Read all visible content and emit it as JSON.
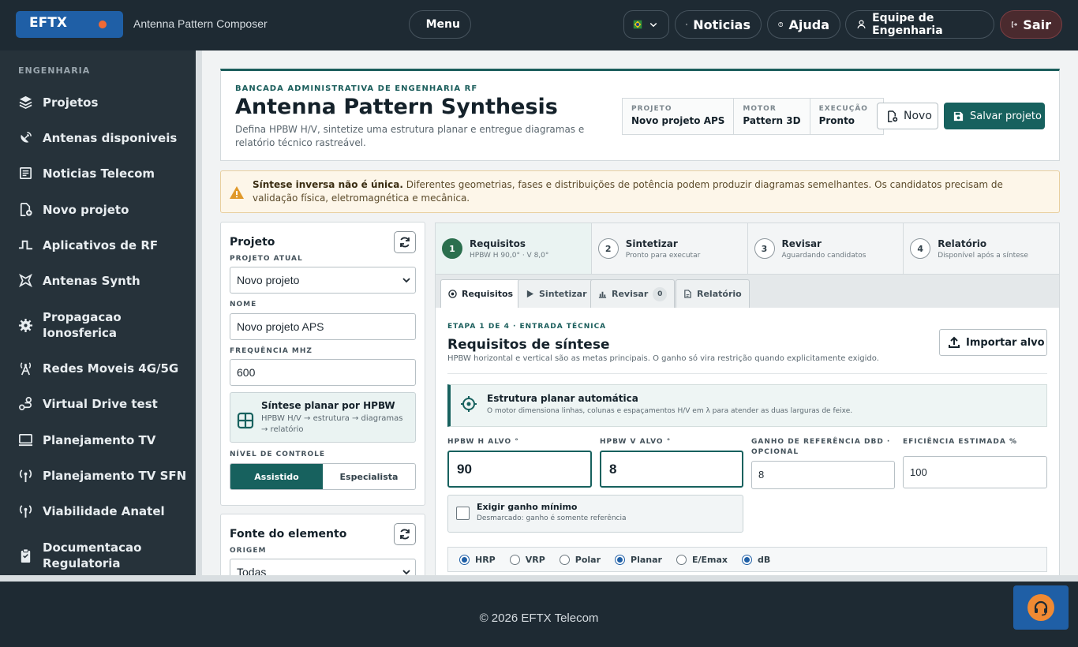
{
  "topbar": {
    "brand": "EFTX",
    "app_name": "Antenna Pattern Composer",
    "menu_label": "Menu",
    "news_label": "Noticias",
    "help_label": "Ajuda",
    "team_label": "Equipe de Engenharia",
    "exit_label": "Sair",
    "accent_color": "#1f5fa6"
  },
  "sidebar": {
    "section": "ENGENHARIA",
    "items": [
      {
        "label": "Projetos",
        "icon": "layers-icon"
      },
      {
        "label": "Antenas disponiveis",
        "icon": "satellite-dish-icon"
      },
      {
        "label": "Noticias Telecom",
        "icon": "newspaper-icon"
      },
      {
        "label": "Novo projeto",
        "icon": "file-plus-icon"
      },
      {
        "label": "Aplicativos de RF",
        "icon": "pulse-icon"
      },
      {
        "label": "Antenas Synth",
        "icon": "synth-icon"
      },
      {
        "label": "Propagacao Ionosferica",
        "icon": "gear-icon"
      },
      {
        "label": "Redes Moveis 4G/5G",
        "icon": "tower-icon"
      },
      {
        "label": "Virtual Drive test",
        "icon": "route-icon"
      },
      {
        "label": "Planejamento TV",
        "icon": "monitor-icon"
      },
      {
        "label": "Planejamento TV SFN",
        "icon": "broadcast-icon"
      },
      {
        "label": "Viabilidade Anatel",
        "icon": "broadcast-icon"
      },
      {
        "label": "Documentacao Regulatoria",
        "icon": "clipboard-icon"
      }
    ]
  },
  "hero": {
    "kicker": "BANCADA ADMINISTRATIVA DE ENGENHARIA RF",
    "title": "Antenna Pattern Synthesis",
    "description": "Defina HPBW H/V, sintetize uma estrutura planar e entregue diagramas e relatório técnico rastreável.",
    "meta": [
      {
        "key": "PROJETO",
        "value": "Novo projeto APS"
      },
      {
        "key": "MOTOR",
        "value": "Pattern 3D"
      },
      {
        "key": "EXECUÇÃO",
        "value": "Pronto"
      }
    ],
    "new_label": "Novo",
    "save_label": "Salvar projeto"
  },
  "warning": {
    "bold": "Síntese inversa não é única.",
    "text": " Diferentes geometrias, fases e distribuições de potência podem produzir diagramas semelhantes. Os candidatos precisam de validação física, eletromagnética e mecânica."
  },
  "project_panel": {
    "title": "Projeto",
    "current_label": "PROJETO ATUAL",
    "current_value": "Novo projeto",
    "name_label": "NOME",
    "name_value": "Novo projeto APS",
    "freq_label": "FREQUÊNCIA MHZ",
    "freq_value": "600",
    "card_title": "Síntese planar por HPBW",
    "card_sub": "HPBW H/V → estrutura → diagramas → relatório",
    "control_label": "NÍVEL DE CONTROLE",
    "control_options": [
      "Assistido",
      "Especialista"
    ],
    "control_selected": "Assistido"
  },
  "source_panel": {
    "title": "Fonte do elemento",
    "origin_label": "ORIGEM",
    "origin_value": "Todas"
  },
  "steps": [
    {
      "num": "1",
      "title": "Requisitos",
      "sub": "HPBW H 90,0° · V 8,0°"
    },
    {
      "num": "2",
      "title": "Sintetizar",
      "sub": "Pronto para executar"
    },
    {
      "num": "3",
      "title": "Revisar",
      "sub": "Aguardando candidatos"
    },
    {
      "num": "4",
      "title": "Relatório",
      "sub": "Disponível após a síntese"
    }
  ],
  "tabs": [
    {
      "label": "Requisitos"
    },
    {
      "label": "Sintetizar"
    },
    {
      "label": "Revisar",
      "badge": "0"
    },
    {
      "label": "Relatório"
    }
  ],
  "content": {
    "kicker": "ETAPA 1 DE 4 · ENTRADA TÉCNICA",
    "title": "Requisitos de síntese",
    "subtitle": "HPBW horizontal e vertical são as metas principais. O ganho só vira restrição quando explicitamente exigido.",
    "import_label": "Importar alvo",
    "auto_title": "Estrutura planar automática",
    "auto_sub": "O motor dimensiona linhas, colunas e espaçamentos H/V em λ para atender as duas larguras de feixe.",
    "hpbw_h_label": "HPBW H ALVO °",
    "hpbw_h_value": "90",
    "hpbw_v_label": "HPBW V ALVO °",
    "hpbw_v_value": "8",
    "gain_label": "GANHO DE REFERÊNCIA DBD · OPCIONAL",
    "gain_value": "8",
    "eff_label": "EFICIÊNCIA ESTIMADA %",
    "eff_value": "100",
    "min_gain_title": "Exigir ganho mínimo",
    "min_gain_sub": "Desmarcado: ganho é somente referência",
    "radios": [
      {
        "label": "HRP",
        "checked": true
      },
      {
        "label": "VRP",
        "checked": false
      },
      {
        "label": "Polar",
        "checked": false
      },
      {
        "label": "Planar",
        "checked": true
      },
      {
        "label": "E/Emax",
        "checked": false
      },
      {
        "label": "dB",
        "checked": true
      }
    ]
  },
  "footer": {
    "text": "© 2026 EFTX Telecom"
  }
}
